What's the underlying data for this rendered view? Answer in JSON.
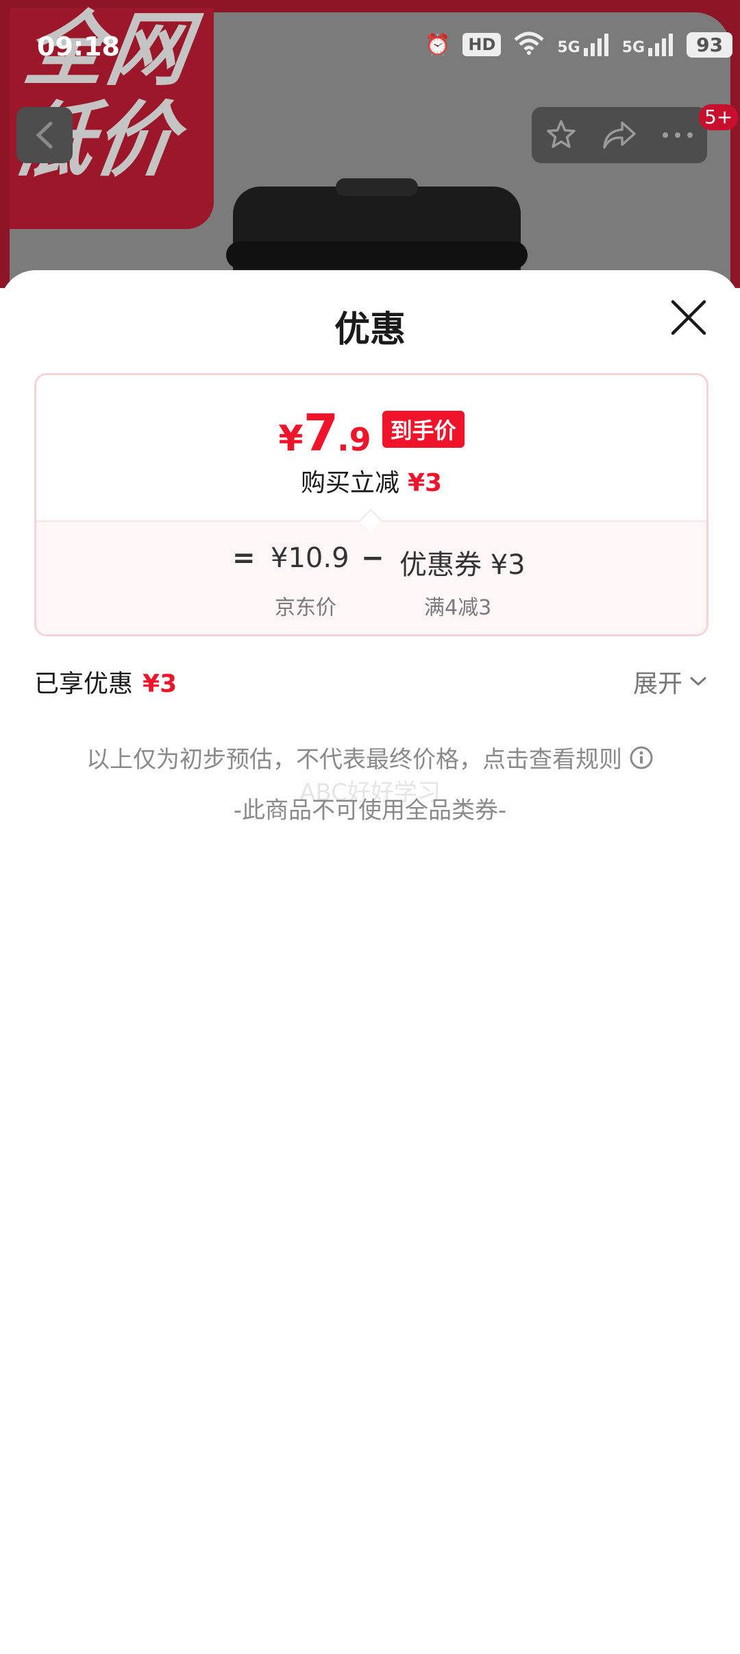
{
  "status_bar": {
    "time": "09:18",
    "hd": "HD",
    "signal_1": "5G",
    "signal_2": "5G",
    "battery": "93"
  },
  "background": {
    "promo_text": "全网低价",
    "cart_badge": "5+"
  },
  "sheet": {
    "title": "优惠",
    "final_price": {
      "currency": "¥",
      "integer": "7",
      "decimal": ".9",
      "tag": "到手价"
    },
    "instant_reduce": {
      "label": "购买立减",
      "amount": "¥3"
    },
    "formula": {
      "equals": "=",
      "jd_price": "¥10.9",
      "minus": "−",
      "coupon": "优惠券 ¥3",
      "jd_price_label": "京东价",
      "coupon_rule": "满4减3"
    },
    "enjoyed": {
      "label": "已享优惠",
      "amount": "¥3"
    },
    "expand_label": "展开",
    "notice": "以上仅为初步预估，不代表最终价格，点击查看规则",
    "watermark": "ABC好好学习",
    "coupon_note": "-此商品不可使用全品类券-"
  },
  "colors": {
    "accent": "#f0142a",
    "card_border": "#f6d3d7",
    "backdrop": "#8d1525"
  }
}
